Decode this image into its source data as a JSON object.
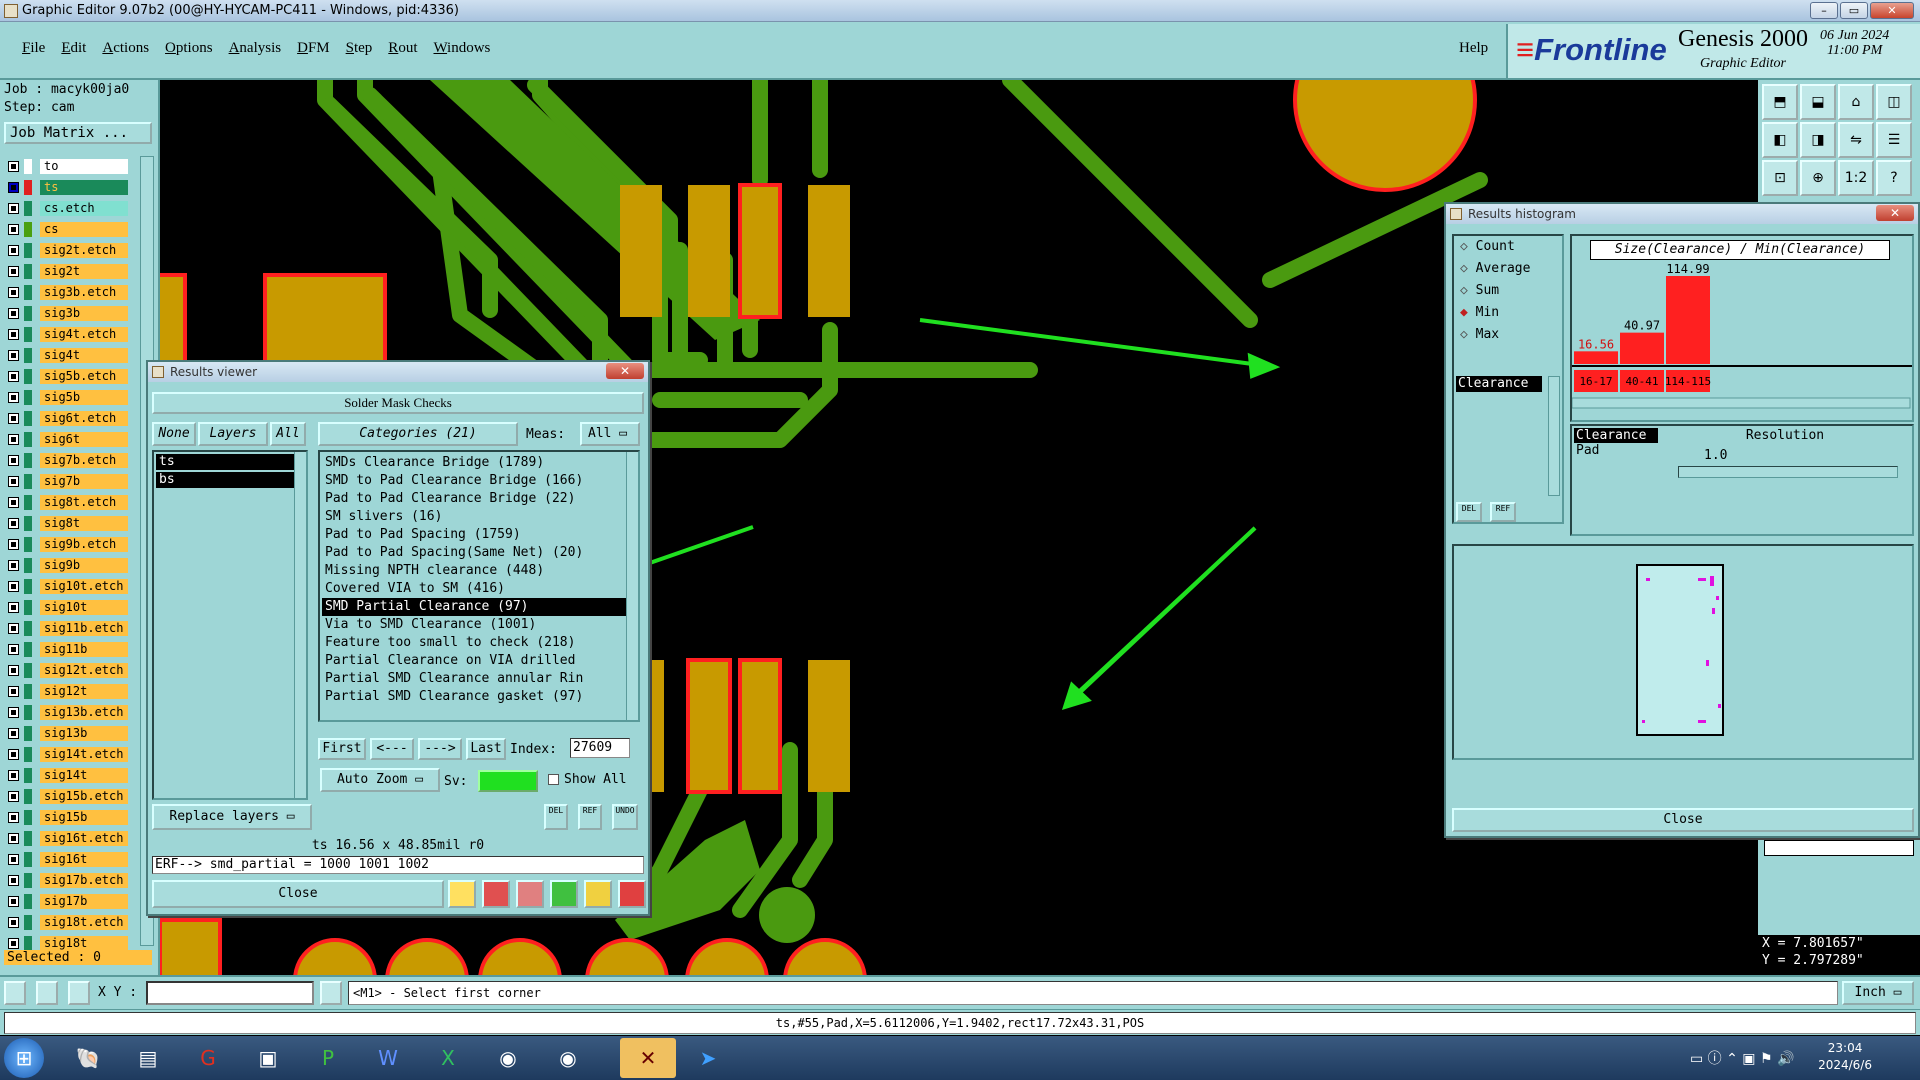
{
  "window": {
    "title": "Graphic Editor 9.07b2 (00@HY-HYCAM-PC411 - Windows, pid:4336)"
  },
  "menu": {
    "items": [
      "File",
      "Edit",
      "Actions",
      "Options",
      "Analysis",
      "DFM",
      "Step",
      "Rout",
      "Windows"
    ],
    "help": "Help"
  },
  "brand": {
    "logo": "Frontline",
    "product": "Genesis 2000",
    "subtitle": "Graphic Editor",
    "date": "06 Jun 2024",
    "time": "11:00 PM"
  },
  "job": {
    "job_label": "Job : macyk00ja0",
    "step_label": "Step: cam",
    "matrix_button": "Job Matrix ..."
  },
  "layers": [
    "to",
    "ts",
    "cs.etch",
    "cs",
    "sig2t.etch",
    "sig2t",
    "sig3b.etch",
    "sig3b",
    "sig4t.etch",
    "sig4t",
    "sig5b.etch",
    "sig5b",
    "sig6t.etch",
    "sig6t",
    "sig7b.etch",
    "sig7b",
    "sig8t.etch",
    "sig8t",
    "sig9b.etch",
    "sig9b",
    "sig10t.etch",
    "sig10t",
    "sig11b.etch",
    "sig11b",
    "sig12t.etch",
    "sig12t",
    "sig13b.etch",
    "sig13b",
    "sig14t.etch",
    "sig14t",
    "sig15b.etch",
    "sig15b",
    "sig16t.etch",
    "sig16t",
    "sig17b.etch",
    "sig17b",
    "sig18t.etch",
    "sig18t"
  ],
  "selected": "Selected : 0",
  "results_viewer": {
    "title": "Results viewer",
    "header": "Solder Mask Checks",
    "btn_none": "None",
    "btn_layers": "Layers",
    "btn_all": "All",
    "categories_label": "Categories (21)",
    "meas_label": "Meas:",
    "meas_value": "All",
    "layer_list": [
      "ts",
      "bs"
    ],
    "categories": [
      "SMDs Clearance Bridge (1789)",
      "SMD to Pad Clearance Bridge (166)",
      "Pad to Pad Clearance Bridge (22)",
      "SM slivers (16)",
      "Pad to Pad Spacing (1759)",
      "Pad to Pad Spacing(Same Net) (20)",
      "Missing NPTH clearance (448)",
      "Covered VIA to SM (416)",
      "SMD Partial Clearance (97)",
      "Via to SMD Clearance (1001)",
      "Feature too small to check (218)",
      "Partial Clearance on VIA drilled",
      "Partial SMD Clearance annular Rin",
      "Partial SMD Clearance gasket (97)"
    ],
    "selected_category": "SMD Partial Clearance (97)",
    "nav": {
      "first": "First",
      "prev": "<---",
      "next": "--->",
      "last": "Last",
      "index_label": "Index:",
      "index_value": "27609"
    },
    "auto_zoom": "Auto Zoom",
    "sv_label": "Sv:",
    "show_all": "Show All",
    "replace_layers": "Replace layers",
    "measurement": "ts 16.56 x 48.85mil  r0",
    "erf": "ERF--> smd_partial = 1000 1001 1002",
    "close": "Close",
    "small_btns": [
      "DEL",
      "REF",
      "UNDO"
    ]
  },
  "histogram": {
    "title": "Results histogram",
    "options": [
      "Count",
      "Average",
      "Sum",
      "Min",
      "Max"
    ],
    "selected_option": "Min",
    "left_list": [
      "Clearance"
    ],
    "chart_title": "Size(Clearance) / Min(Clearance)",
    "resolution_label": "Resolution",
    "resolution_value": "1.0",
    "lower_list": [
      "Clearance",
      "Pad"
    ],
    "close": "Close",
    "small_btns": [
      "DEL",
      "REF"
    ]
  },
  "chart_data": {
    "type": "bar",
    "categories": [
      "16-17",
      "40-41",
      "114-115"
    ],
    "values": [
      16.56,
      40.97,
      114.99
    ],
    "title": "Size(Clearance) / Min(Clearance)",
    "color": "#ff2020"
  },
  "command": {
    "xy_label": "X Y :",
    "prompt": "<M1> - Select first corner",
    "units": "Inch"
  },
  "coords": {
    "x": "X = 7.801657\"",
    "y": "Y = 2.797289\""
  },
  "status": "ts,#55,Pad,X=5.6112006,Y=1.9402,rect17.72x43.31,POS",
  "taskbar": {
    "time": "23:04",
    "date": "2024/6/6"
  },
  "colors": {
    "panel": "#9ed6d6",
    "pad": "#c89a00",
    "trace": "#4a9a10",
    "highlight": "#ff2020",
    "arrow": "#20e020"
  }
}
